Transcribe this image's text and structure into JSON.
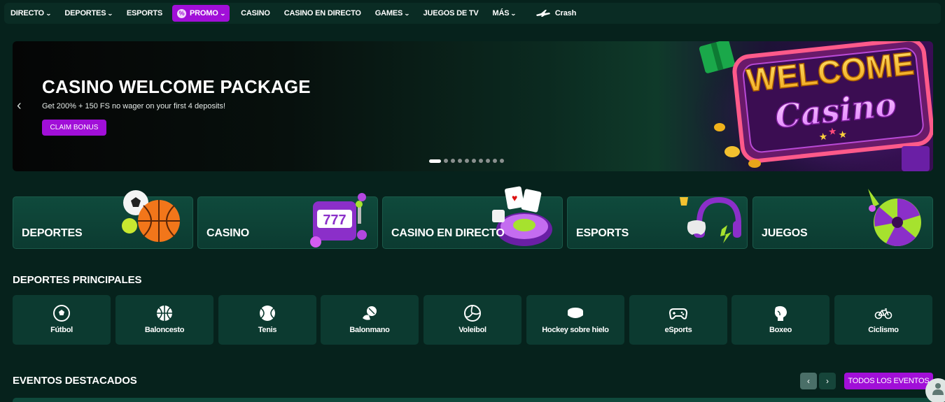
{
  "nav": {
    "items": [
      {
        "label": "DIRECTO",
        "chevron": true
      },
      {
        "label": "DEPORTES",
        "chevron": true
      },
      {
        "label": "ESPORTS",
        "chevron": false
      },
      {
        "label": "PROMO",
        "chevron": true
      },
      {
        "label": "CASINO",
        "chevron": false
      },
      {
        "label": "CASINO EN DIRECTO",
        "chevron": false
      },
      {
        "label": "GAMES",
        "chevron": true
      },
      {
        "label": "JUEGOS DE TV",
        "chevron": false
      },
      {
        "label": "MÁS",
        "chevron": true
      },
      {
        "label": "Crash",
        "chevron": false
      }
    ]
  },
  "hero": {
    "title": "CASINO WELCOME PACKAGE",
    "subtitle": "Get 200% + 150 FS no wager on your first 4 deposits!",
    "cta": "CLAIM BONUS",
    "art_line1": "WELCOME",
    "art_line2": "Casino",
    "slide_count": 10,
    "active_slide": 1
  },
  "categories": [
    {
      "label": "DEPORTES",
      "icon": "sports-balls-icon"
    },
    {
      "label": "CASINO",
      "icon": "slot-machine-icon"
    },
    {
      "label": "CASINO EN DIRECTO",
      "icon": "roulette-icon"
    },
    {
      "label": "ESPORTS",
      "icon": "headset-icon"
    },
    {
      "label": "JUEGOS",
      "icon": "wheel-icon"
    }
  ],
  "deportes_principales": {
    "title": "DEPORTES PRINCIPALES",
    "items": [
      {
        "label": "Fútbol",
        "icon": "soccer-ball-icon"
      },
      {
        "label": "Baloncesto",
        "icon": "basketball-icon"
      },
      {
        "label": "Tenis",
        "icon": "tennis-ball-icon"
      },
      {
        "label": "Balonmano",
        "icon": "handball-icon"
      },
      {
        "label": "Voleibol",
        "icon": "volleyball-icon"
      },
      {
        "label": "Hockey sobre hielo",
        "icon": "hockey-puck-icon"
      },
      {
        "label": "eSports",
        "icon": "gamepad-icon"
      },
      {
        "label": "Boxeo",
        "icon": "boxing-glove-icon"
      },
      {
        "label": "Ciclismo",
        "icon": "bicycle-icon"
      }
    ]
  },
  "eventos": {
    "title": "EVENTOS DESTACADOS",
    "todos_label": "TODOS LOS EVENTOS"
  },
  "colors": {
    "accent": "#a10fd8",
    "background": "#06221c",
    "card": "#0c3a30"
  }
}
